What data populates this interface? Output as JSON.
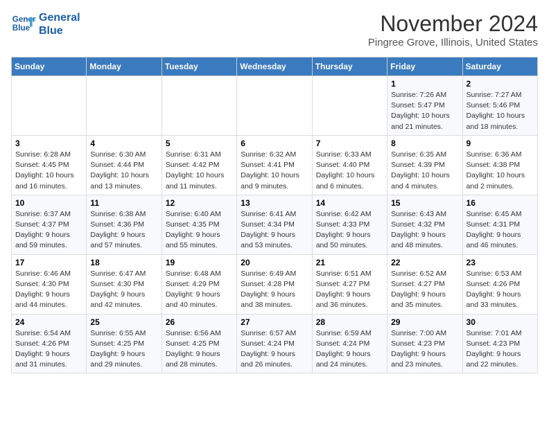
{
  "header": {
    "logo_line1": "General",
    "logo_line2": "Blue",
    "month_title": "November 2024",
    "location": "Pingree Grove, Illinois, United States"
  },
  "weekdays": [
    "Sunday",
    "Monday",
    "Tuesday",
    "Wednesday",
    "Thursday",
    "Friday",
    "Saturday"
  ],
  "weeks": [
    [
      {
        "day": "",
        "info": ""
      },
      {
        "day": "",
        "info": ""
      },
      {
        "day": "",
        "info": ""
      },
      {
        "day": "",
        "info": ""
      },
      {
        "day": "",
        "info": ""
      },
      {
        "day": "1",
        "info": "Sunrise: 7:26 AM\nSunset: 5:47 PM\nDaylight: 10 hours and 21 minutes."
      },
      {
        "day": "2",
        "info": "Sunrise: 7:27 AM\nSunset: 5:46 PM\nDaylight: 10 hours and 18 minutes."
      }
    ],
    [
      {
        "day": "3",
        "info": "Sunrise: 6:28 AM\nSunset: 4:45 PM\nDaylight: 10 hours and 16 minutes."
      },
      {
        "day": "4",
        "info": "Sunrise: 6:30 AM\nSunset: 4:44 PM\nDaylight: 10 hours and 13 minutes."
      },
      {
        "day": "5",
        "info": "Sunrise: 6:31 AM\nSunset: 4:42 PM\nDaylight: 10 hours and 11 minutes."
      },
      {
        "day": "6",
        "info": "Sunrise: 6:32 AM\nSunset: 4:41 PM\nDaylight: 10 hours and 9 minutes."
      },
      {
        "day": "7",
        "info": "Sunrise: 6:33 AM\nSunset: 4:40 PM\nDaylight: 10 hours and 6 minutes."
      },
      {
        "day": "8",
        "info": "Sunrise: 6:35 AM\nSunset: 4:39 PM\nDaylight: 10 hours and 4 minutes."
      },
      {
        "day": "9",
        "info": "Sunrise: 6:36 AM\nSunset: 4:38 PM\nDaylight: 10 hours and 2 minutes."
      }
    ],
    [
      {
        "day": "10",
        "info": "Sunrise: 6:37 AM\nSunset: 4:37 PM\nDaylight: 9 hours and 59 minutes."
      },
      {
        "day": "11",
        "info": "Sunrise: 6:38 AM\nSunset: 4:36 PM\nDaylight: 9 hours and 57 minutes."
      },
      {
        "day": "12",
        "info": "Sunrise: 6:40 AM\nSunset: 4:35 PM\nDaylight: 9 hours and 55 minutes."
      },
      {
        "day": "13",
        "info": "Sunrise: 6:41 AM\nSunset: 4:34 PM\nDaylight: 9 hours and 53 minutes."
      },
      {
        "day": "14",
        "info": "Sunrise: 6:42 AM\nSunset: 4:33 PM\nDaylight: 9 hours and 50 minutes."
      },
      {
        "day": "15",
        "info": "Sunrise: 6:43 AM\nSunset: 4:32 PM\nDaylight: 9 hours and 48 minutes."
      },
      {
        "day": "16",
        "info": "Sunrise: 6:45 AM\nSunset: 4:31 PM\nDaylight: 9 hours and 46 minutes."
      }
    ],
    [
      {
        "day": "17",
        "info": "Sunrise: 6:46 AM\nSunset: 4:30 PM\nDaylight: 9 hours and 44 minutes."
      },
      {
        "day": "18",
        "info": "Sunrise: 6:47 AM\nSunset: 4:30 PM\nDaylight: 9 hours and 42 minutes."
      },
      {
        "day": "19",
        "info": "Sunrise: 6:48 AM\nSunset: 4:29 PM\nDaylight: 9 hours and 40 minutes."
      },
      {
        "day": "20",
        "info": "Sunrise: 6:49 AM\nSunset: 4:28 PM\nDaylight: 9 hours and 38 minutes."
      },
      {
        "day": "21",
        "info": "Sunrise: 6:51 AM\nSunset: 4:27 PM\nDaylight: 9 hours and 36 minutes."
      },
      {
        "day": "22",
        "info": "Sunrise: 6:52 AM\nSunset: 4:27 PM\nDaylight: 9 hours and 35 minutes."
      },
      {
        "day": "23",
        "info": "Sunrise: 6:53 AM\nSunset: 4:26 PM\nDaylight: 9 hours and 33 minutes."
      }
    ],
    [
      {
        "day": "24",
        "info": "Sunrise: 6:54 AM\nSunset: 4:26 PM\nDaylight: 9 hours and 31 minutes."
      },
      {
        "day": "25",
        "info": "Sunrise: 6:55 AM\nSunset: 4:25 PM\nDaylight: 9 hours and 29 minutes."
      },
      {
        "day": "26",
        "info": "Sunrise: 6:56 AM\nSunset: 4:25 PM\nDaylight: 9 hours and 28 minutes."
      },
      {
        "day": "27",
        "info": "Sunrise: 6:57 AM\nSunset: 4:24 PM\nDaylight: 9 hours and 26 minutes."
      },
      {
        "day": "28",
        "info": "Sunrise: 6:59 AM\nSunset: 4:24 PM\nDaylight: 9 hours and 24 minutes."
      },
      {
        "day": "29",
        "info": "Sunrise: 7:00 AM\nSunset: 4:23 PM\nDaylight: 9 hours and 23 minutes."
      },
      {
        "day": "30",
        "info": "Sunrise: 7:01 AM\nSunset: 4:23 PM\nDaylight: 9 hours and 22 minutes."
      }
    ]
  ]
}
